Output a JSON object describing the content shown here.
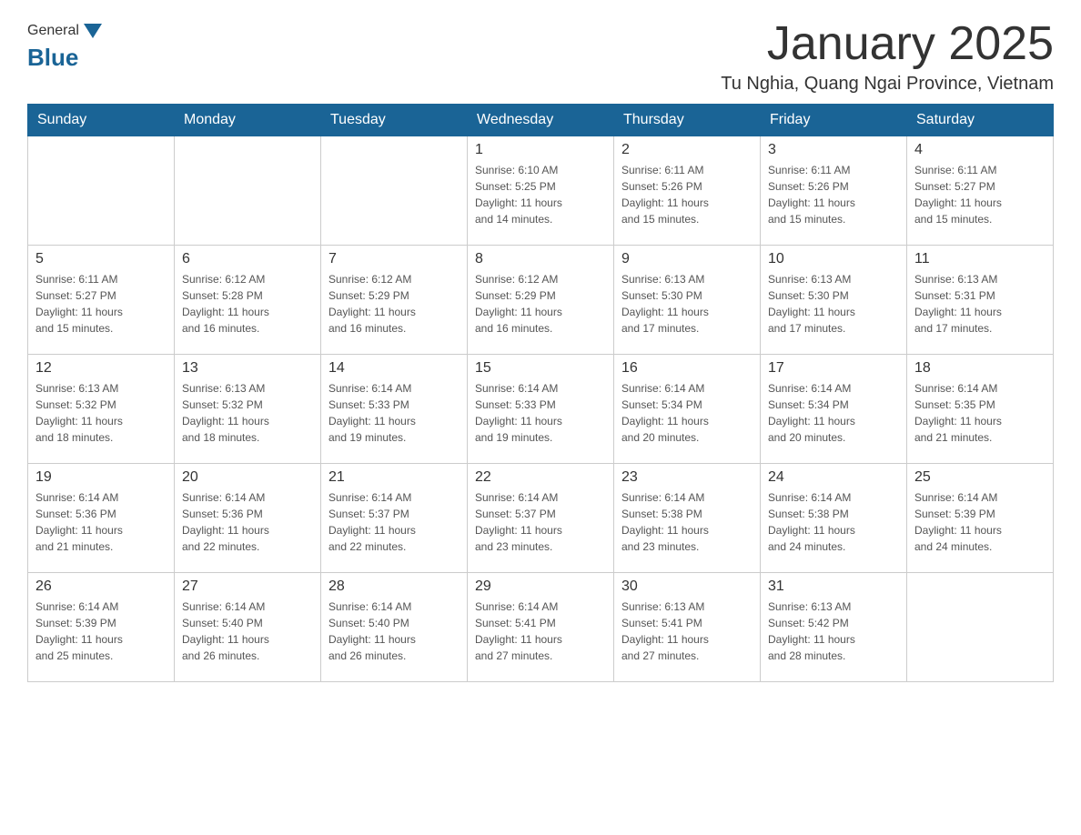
{
  "header": {
    "logo_general": "General",
    "logo_blue": "Blue",
    "month_title": "January 2025",
    "location": "Tu Nghia, Quang Ngai Province, Vietnam"
  },
  "days_of_week": [
    "Sunday",
    "Monday",
    "Tuesday",
    "Wednesday",
    "Thursday",
    "Friday",
    "Saturday"
  ],
  "weeks": [
    [
      {
        "day": "",
        "info": ""
      },
      {
        "day": "",
        "info": ""
      },
      {
        "day": "",
        "info": ""
      },
      {
        "day": "1",
        "info": "Sunrise: 6:10 AM\nSunset: 5:25 PM\nDaylight: 11 hours\nand 14 minutes."
      },
      {
        "day": "2",
        "info": "Sunrise: 6:11 AM\nSunset: 5:26 PM\nDaylight: 11 hours\nand 15 minutes."
      },
      {
        "day": "3",
        "info": "Sunrise: 6:11 AM\nSunset: 5:26 PM\nDaylight: 11 hours\nand 15 minutes."
      },
      {
        "day": "4",
        "info": "Sunrise: 6:11 AM\nSunset: 5:27 PM\nDaylight: 11 hours\nand 15 minutes."
      }
    ],
    [
      {
        "day": "5",
        "info": "Sunrise: 6:11 AM\nSunset: 5:27 PM\nDaylight: 11 hours\nand 15 minutes."
      },
      {
        "day": "6",
        "info": "Sunrise: 6:12 AM\nSunset: 5:28 PM\nDaylight: 11 hours\nand 16 minutes."
      },
      {
        "day": "7",
        "info": "Sunrise: 6:12 AM\nSunset: 5:29 PM\nDaylight: 11 hours\nand 16 minutes."
      },
      {
        "day": "8",
        "info": "Sunrise: 6:12 AM\nSunset: 5:29 PM\nDaylight: 11 hours\nand 16 minutes."
      },
      {
        "day": "9",
        "info": "Sunrise: 6:13 AM\nSunset: 5:30 PM\nDaylight: 11 hours\nand 17 minutes."
      },
      {
        "day": "10",
        "info": "Sunrise: 6:13 AM\nSunset: 5:30 PM\nDaylight: 11 hours\nand 17 minutes."
      },
      {
        "day": "11",
        "info": "Sunrise: 6:13 AM\nSunset: 5:31 PM\nDaylight: 11 hours\nand 17 minutes."
      }
    ],
    [
      {
        "day": "12",
        "info": "Sunrise: 6:13 AM\nSunset: 5:32 PM\nDaylight: 11 hours\nand 18 minutes."
      },
      {
        "day": "13",
        "info": "Sunrise: 6:13 AM\nSunset: 5:32 PM\nDaylight: 11 hours\nand 18 minutes."
      },
      {
        "day": "14",
        "info": "Sunrise: 6:14 AM\nSunset: 5:33 PM\nDaylight: 11 hours\nand 19 minutes."
      },
      {
        "day": "15",
        "info": "Sunrise: 6:14 AM\nSunset: 5:33 PM\nDaylight: 11 hours\nand 19 minutes."
      },
      {
        "day": "16",
        "info": "Sunrise: 6:14 AM\nSunset: 5:34 PM\nDaylight: 11 hours\nand 20 minutes."
      },
      {
        "day": "17",
        "info": "Sunrise: 6:14 AM\nSunset: 5:34 PM\nDaylight: 11 hours\nand 20 minutes."
      },
      {
        "day": "18",
        "info": "Sunrise: 6:14 AM\nSunset: 5:35 PM\nDaylight: 11 hours\nand 21 minutes."
      }
    ],
    [
      {
        "day": "19",
        "info": "Sunrise: 6:14 AM\nSunset: 5:36 PM\nDaylight: 11 hours\nand 21 minutes."
      },
      {
        "day": "20",
        "info": "Sunrise: 6:14 AM\nSunset: 5:36 PM\nDaylight: 11 hours\nand 22 minutes."
      },
      {
        "day": "21",
        "info": "Sunrise: 6:14 AM\nSunset: 5:37 PM\nDaylight: 11 hours\nand 22 minutes."
      },
      {
        "day": "22",
        "info": "Sunrise: 6:14 AM\nSunset: 5:37 PM\nDaylight: 11 hours\nand 23 minutes."
      },
      {
        "day": "23",
        "info": "Sunrise: 6:14 AM\nSunset: 5:38 PM\nDaylight: 11 hours\nand 23 minutes."
      },
      {
        "day": "24",
        "info": "Sunrise: 6:14 AM\nSunset: 5:38 PM\nDaylight: 11 hours\nand 24 minutes."
      },
      {
        "day": "25",
        "info": "Sunrise: 6:14 AM\nSunset: 5:39 PM\nDaylight: 11 hours\nand 24 minutes."
      }
    ],
    [
      {
        "day": "26",
        "info": "Sunrise: 6:14 AM\nSunset: 5:39 PM\nDaylight: 11 hours\nand 25 minutes."
      },
      {
        "day": "27",
        "info": "Sunrise: 6:14 AM\nSunset: 5:40 PM\nDaylight: 11 hours\nand 26 minutes."
      },
      {
        "day": "28",
        "info": "Sunrise: 6:14 AM\nSunset: 5:40 PM\nDaylight: 11 hours\nand 26 minutes."
      },
      {
        "day": "29",
        "info": "Sunrise: 6:14 AM\nSunset: 5:41 PM\nDaylight: 11 hours\nand 27 minutes."
      },
      {
        "day": "30",
        "info": "Sunrise: 6:13 AM\nSunset: 5:41 PM\nDaylight: 11 hours\nand 27 minutes."
      },
      {
        "day": "31",
        "info": "Sunrise: 6:13 AM\nSunset: 5:42 PM\nDaylight: 11 hours\nand 28 minutes."
      },
      {
        "day": "",
        "info": ""
      }
    ]
  ]
}
